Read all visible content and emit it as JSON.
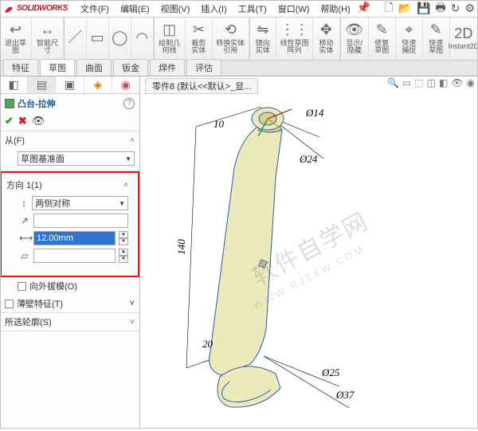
{
  "app": {
    "logo_text": "SOLIDWORKS"
  },
  "menu": {
    "file": "文件(F)",
    "edit": "编辑(E)",
    "view": "视图(V)",
    "insert": "插入(I)",
    "tools": "工具(T)",
    "window": "窗口(W)",
    "help": "帮助(H)"
  },
  "ribbon": {
    "exit_sketch": "退出草图",
    "smart_dim": "智能尺寸",
    "draw_geo": "绘制几何线",
    "trim": "裁剪实体",
    "convert": "转换实体引用",
    "mirror": "镜向实体",
    "pattern": "线性草图阵列",
    "move": "移动实体",
    "show_hide": "显示/隐藏",
    "fix": "修复草图",
    "snap": "快速捕捉",
    "quick_sketch": "快速草图",
    "instant2d": "Instant2D"
  },
  "tabs": {
    "feature": "特征",
    "sketch": "草图",
    "surface": "曲面",
    "sheet": "钣金",
    "weld": "焊件",
    "eval": "评估"
  },
  "panel": {
    "title": "凸台-拉伸",
    "from_label": "从(F)",
    "from_value": "草图基准面",
    "dir_label": "方向 1(1)",
    "dir_mode": "两侧对称",
    "depth": "12.00mm",
    "draft_out": "向外拔模(O)",
    "thin": "薄壁特征(T)",
    "contour": "所选轮廓(S)"
  },
  "doc": {
    "tab": "零件8 (默认<<默认>_显..."
  },
  "dims": {
    "d10": "10",
    "d14": "Ø14",
    "d24": "Ø24",
    "d140": "140",
    "d20": "20",
    "d25": "Ø25",
    "d37": "Ø37"
  },
  "watermark": {
    "main": "软件自学网",
    "sub": "WWW.RJZXW.COM"
  }
}
